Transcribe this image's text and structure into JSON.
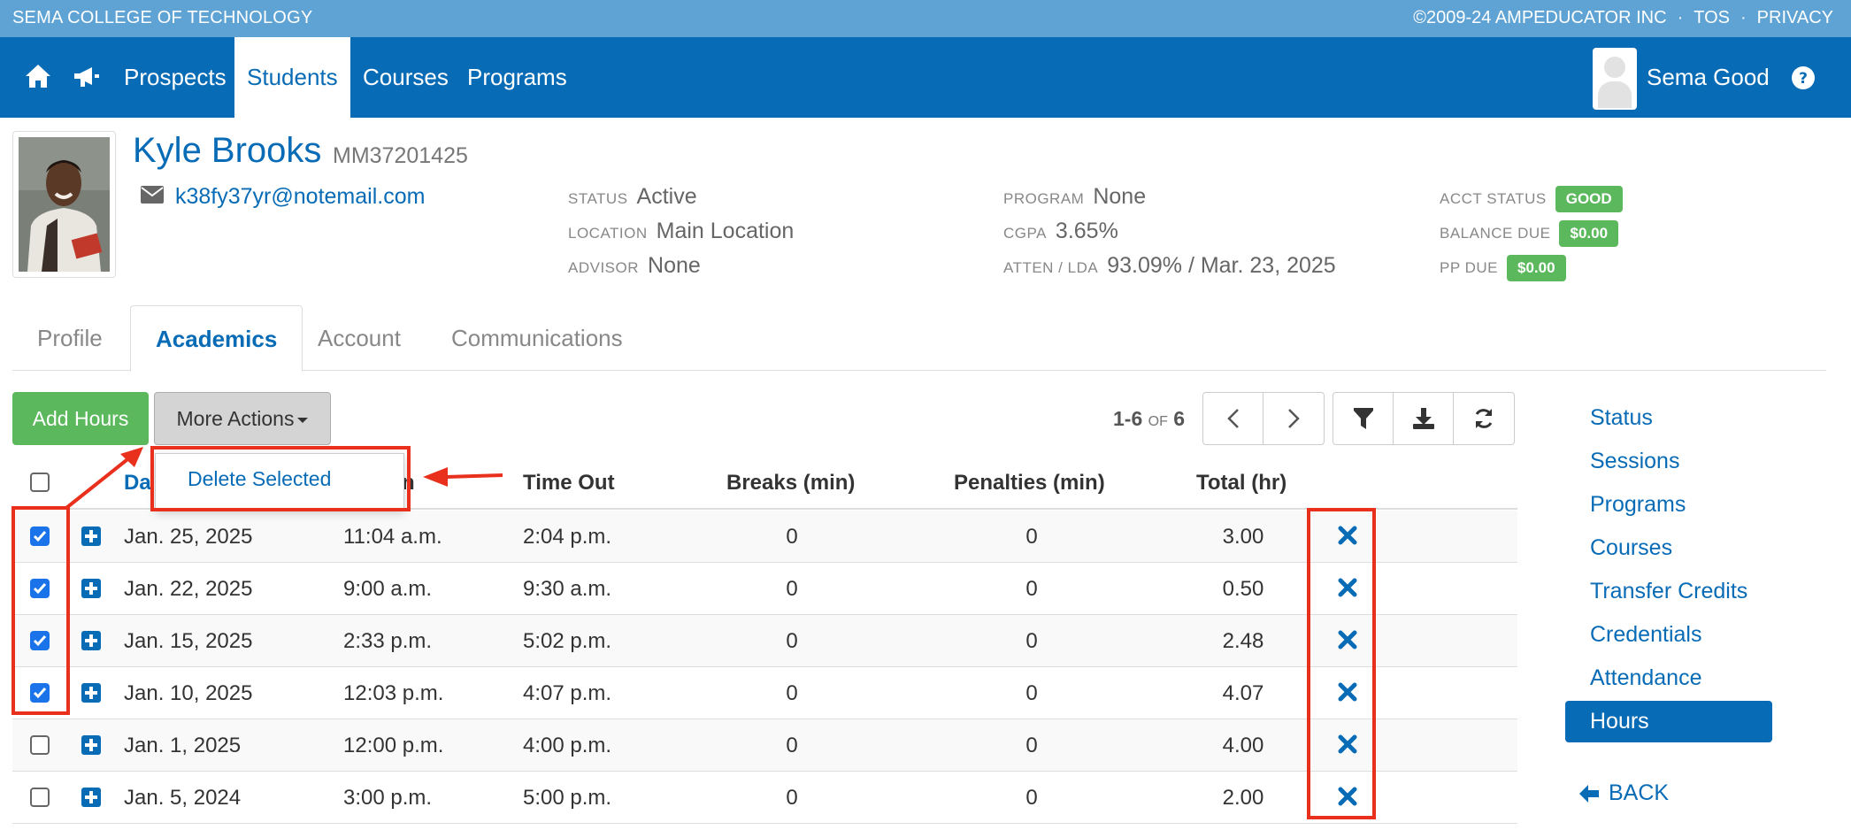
{
  "top_strip": {
    "school": "SEMA COLLEGE OF TECHNOLOGY",
    "copyright": "©2009-24 AMPEDUCATOR INC",
    "tos": "TOS",
    "privacy": "PRIVACY",
    "separator": "·"
  },
  "nav": {
    "items": [
      "Prospects",
      "Students",
      "Courses",
      "Programs"
    ],
    "active": "Students",
    "user": "Sema Good",
    "icons": [
      "home-icon",
      "megaphone-icon",
      "help-icon"
    ]
  },
  "student": {
    "name": "Kyle Brooks",
    "id": "MM37201425",
    "email": "k38fy37yr@notemail.com",
    "status_label": "STATUS",
    "status": "Active",
    "location_label": "LOCATION",
    "location": "Main Location",
    "advisor_label": "ADVISOR",
    "advisor": "None",
    "program_label": "PROGRAM",
    "program": "None",
    "cgpa_label": "CGPA",
    "cgpa": "3.65%",
    "atten_label": "ATTEN / LDA",
    "atten": "93.09% / Mar. 23, 2025",
    "acct_status_label": "ACCT STATUS",
    "acct_status": "GOOD",
    "balance_due_label": "BALANCE DUE",
    "balance_due": "$0.00",
    "pp_due_label": "PP DUE",
    "pp_due": "$0.00"
  },
  "tabs": [
    "Profile",
    "Academics",
    "Account",
    "Communications"
  ],
  "toolbar": {
    "add_hours": "Add Hours",
    "more_actions": "More Actions",
    "delete_selected": "Delete Selected",
    "range": "1-6",
    "of": "OF",
    "total": "6"
  },
  "table": {
    "headers": {
      "date": "Da",
      "time_in": "n",
      "time_out": "Time Out",
      "breaks": "Breaks (min)",
      "penalties": "Penalties (min)",
      "total": "Total (hr)"
    },
    "rows": [
      {
        "checked": true,
        "date": "Jan. 25, 2025",
        "time_in": "11:04 a.m.",
        "time_out": "2:04 p.m.",
        "breaks": "0",
        "penalties": "0",
        "total": "3.00"
      },
      {
        "checked": true,
        "date": "Jan. 22, 2025",
        "time_in": "9:00 a.m.",
        "time_out": "9:30 a.m.",
        "breaks": "0",
        "penalties": "0",
        "total": "0.50"
      },
      {
        "checked": true,
        "date": "Jan. 15, 2025",
        "time_in": "2:33 p.m.",
        "time_out": "5:02 p.m.",
        "breaks": "0",
        "penalties": "0",
        "total": "2.48"
      },
      {
        "checked": true,
        "date": "Jan. 10, 2025",
        "time_in": "12:03 p.m.",
        "time_out": "4:07 p.m.",
        "breaks": "0",
        "penalties": "0",
        "total": "4.07"
      },
      {
        "checked": false,
        "date": "Jan. 1, 2025",
        "time_in": "12:00 p.m.",
        "time_out": "4:00 p.m.",
        "breaks": "0",
        "penalties": "0",
        "total": "4.00"
      },
      {
        "checked": false,
        "date": "Jan. 5, 2024",
        "time_in": "3:00 p.m.",
        "time_out": "5:00 p.m.",
        "breaks": "0",
        "penalties": "0",
        "total": "2.00"
      }
    ]
  },
  "sidenav": {
    "items": [
      "Status",
      "Sessions",
      "Programs",
      "Courses",
      "Transfer Credits",
      "Credentials",
      "Attendance",
      "Hours"
    ],
    "active": "Hours",
    "back": "BACK"
  },
  "colors": {
    "primary": "#086bb6",
    "top_strip": "#5fa3d4",
    "success": "#5cb85c",
    "annotation": "#e8301c"
  }
}
